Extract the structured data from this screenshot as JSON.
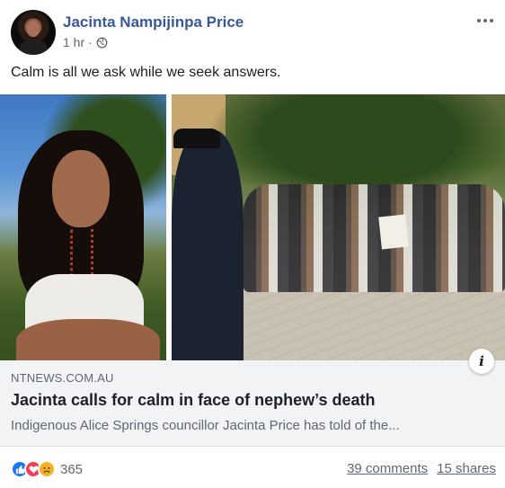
{
  "post": {
    "author": "Jacinta Nampijinpa Price",
    "timestamp": "1 hr",
    "separator": "·",
    "privacy_icon": "globe-icon",
    "more_icon": "more-options-icon",
    "text": "Calm is all we ask while we seek answers."
  },
  "link_preview": {
    "domain": "NTNEWS.COM.AU",
    "headline": "Jacinta calls for calm in face of nephew’s death",
    "description": "Indigenous Alice Springs councillor Jacinta Price has told of the...",
    "info_label": "i"
  },
  "engagement": {
    "reaction_icons": [
      "like-icon",
      "love-icon",
      "sad-icon"
    ],
    "reaction_count": "365",
    "comments": "39 comments",
    "shares": "15 shares"
  },
  "colors": {
    "author_link": "#385898",
    "secondary_text": "#606770",
    "card_background": "#f2f3f5",
    "like": "#1877f2",
    "love": "#f33e58",
    "sad": "#f7b125"
  }
}
